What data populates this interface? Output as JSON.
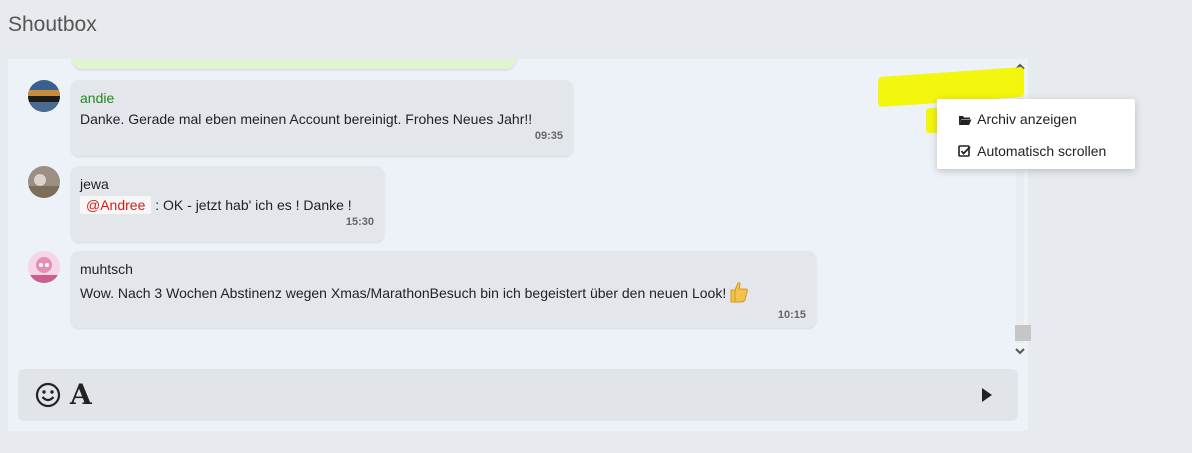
{
  "header": {
    "title": "Shoutbox"
  },
  "messages": [
    {
      "user": "andie",
      "text": "Danke. Gerade mal eben meinen Account bereinigt. Frohes Neues Jahr!!",
      "time": "09:35"
    },
    {
      "user": "jewa",
      "mention": "@Andree",
      "text": ": OK - jetzt hab' ich es ! Danke !",
      "time": "15:30"
    },
    {
      "user": "muhtsch",
      "text": "Wow. Nach 3 Wochen Abstinenz wegen Xmas/MarathonBesuch bin ich begeistert über den neuen Look!",
      "time": "10:15"
    }
  ],
  "menu": {
    "items": [
      {
        "label": "Archiv anzeigen",
        "icon": "folder-open-icon"
      },
      {
        "label": "Automatisch scrollen",
        "icon": "checkbox-checked-icon"
      }
    ]
  },
  "composer": {
    "emoji_icon": "smiley-icon",
    "font_icon": "font-format-icon",
    "font_glyph": "A",
    "send_icon": "send-icon"
  },
  "colors": {
    "username_green": "#1b8a1b",
    "mention_red": "#d21e1e",
    "highlight": "#f3f500"
  }
}
